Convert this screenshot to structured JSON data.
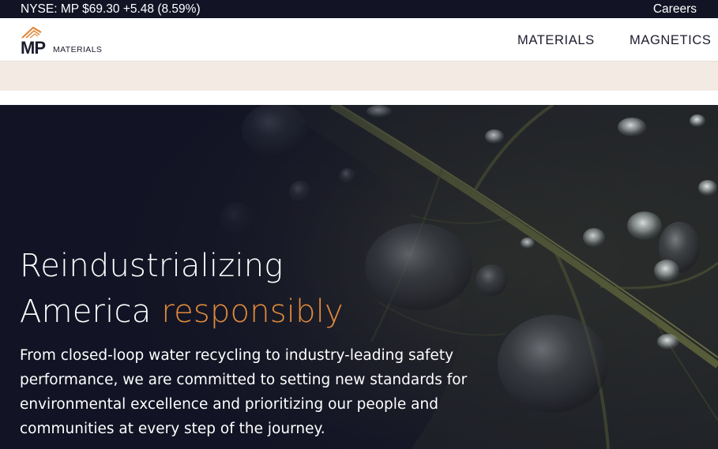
{
  "topbar": {
    "ticker": "NYSE: MP $69.30 +5.48 (8.59%)",
    "careers_label": "Careers"
  },
  "header": {
    "logo": {
      "mark": "MP",
      "wordmark": "MATERIALS"
    },
    "nav": [
      {
        "label": "MATERIALS"
      },
      {
        "label": "MAGNETICS"
      }
    ]
  },
  "hero": {
    "title_line1": "Reindustrializing",
    "title_line2_prefix": "America ",
    "title_line2_accent": "responsibly",
    "body_lines": [
      "From closed-loop water recycling to industry-leading safety",
      "performance, we are committed to setting new standards for",
      "environmental excellence and prioritizing our people and",
      "communities at every step of the journey."
    ],
    "background_image": "leaf-water-droplets-image"
  },
  "colors": {
    "dark_navy": "#121425",
    "accent_orange": "#e08a3c",
    "beige": "#f3eae3",
    "text_dark": "#1b1d2e"
  }
}
